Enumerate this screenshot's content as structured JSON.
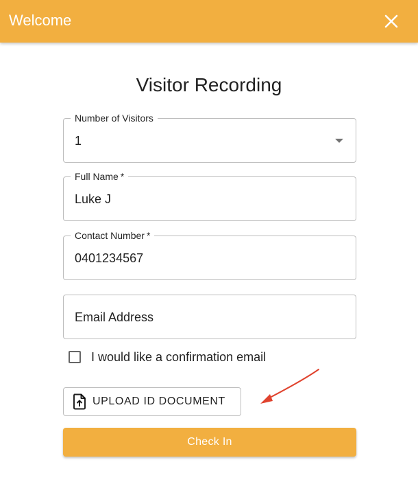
{
  "appbar": {
    "title": "Welcome",
    "color": "#F2AF40"
  },
  "form": {
    "title": "Visitor Recording",
    "visitors": {
      "label": "Number of Visitors",
      "value": "1"
    },
    "full_name": {
      "label": "Full Name",
      "required_marker": "*",
      "value": "Luke J"
    },
    "contact_number": {
      "label": "Contact Number",
      "required_marker": "*",
      "value": "0401234567"
    },
    "email": {
      "placeholder": "Email Address",
      "value": ""
    },
    "confirmation_checkbox": {
      "label": "I would like a confirmation email",
      "checked": false
    },
    "upload_button": {
      "label": "UPLOAD ID DOCUMENT",
      "icon": "file-upload-icon"
    },
    "checkin_button": {
      "label": "Check In",
      "color": "#F2AF40"
    }
  },
  "annotation": {
    "arrow_color": "#E0432E"
  }
}
